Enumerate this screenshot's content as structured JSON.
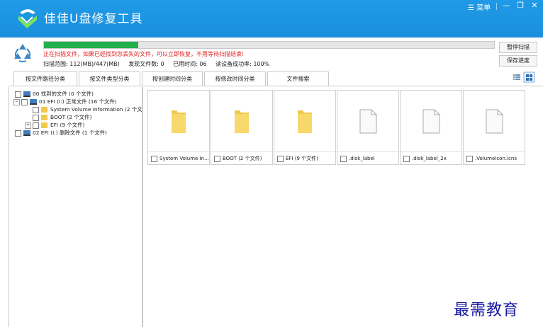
{
  "titlebar": {
    "app_title": "佳佳U盘修复工具",
    "menu_label": "菜单",
    "min_icon": "minimize-icon",
    "max_icon": "maximize-icon",
    "close_icon": "close-icon",
    "bg_color": "#1f9ae6"
  },
  "scan": {
    "progress_percent": 21,
    "warning": "正在扫描文件，如果已经找到您丢失的文件，可以立即恢复，不用等待扫描结束!",
    "range_label": "扫描范围: 112(MB)/447(MB)",
    "found_label": "发现文件数: 0",
    "elapsed_label": "已用时间: 06",
    "success_label": "读设备成功率: 100%",
    "pause_button": "暂停扫描",
    "save_button": "保存进度"
  },
  "tabs": [
    {
      "label": "按文件路径分类"
    },
    {
      "label": "按文件类型分类"
    },
    {
      "label": "按创建时间分类"
    },
    {
      "label": "按修改时间分类"
    },
    {
      "label": "文件搜索"
    }
  ],
  "tree": [
    {
      "label": "00 找到的文件 (0 个文件)"
    },
    {
      "label": "01 EFI (I:) 正常文件 (16 个文件)"
    },
    {
      "label": "System Volume Information     (2 个文"
    },
    {
      "label": "BOOT     (2 个文件)"
    },
    {
      "label": "EFI     (9 个文件)"
    },
    {
      "label": "02 EFI (I:) 删除文件 (1 个文件)"
    }
  ],
  "files": [
    {
      "name": "System Volume In...",
      "type": "folder"
    },
    {
      "name": "BOOT (2 个文件)",
      "type": "folder"
    },
    {
      "name": "EFI (9 个文件)",
      "type": "folder"
    },
    {
      "name": ".disk_label",
      "type": "file"
    },
    {
      "name": ".disk_label_2x",
      "type": "file"
    },
    {
      "name": ".VolumeIcon.icns",
      "type": "file"
    }
  ],
  "watermark": "最需教育",
  "colors": {
    "accent": "#1f9ae6",
    "progress": "#22b14c",
    "warning": "#e02020",
    "folder": "#f2c94c"
  }
}
